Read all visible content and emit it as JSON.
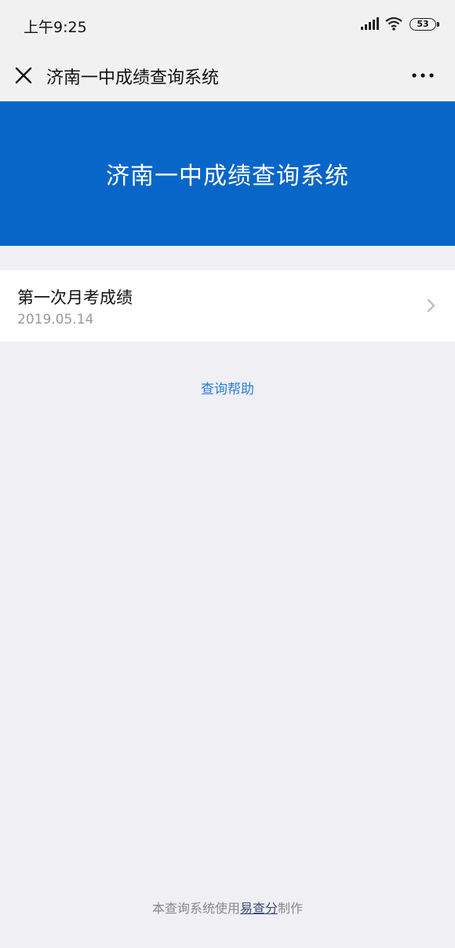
{
  "status_bar": {
    "time": "上午9:25",
    "battery": "53"
  },
  "nav": {
    "title": "济南一中成绩查询系统"
  },
  "banner": {
    "title": "济南一中成绩查询系统"
  },
  "exam_list": [
    {
      "title": "第一次月考成绩",
      "date": "2019.05.14"
    }
  ],
  "help_link": "查询帮助",
  "footer": {
    "prefix": "本查询系统使用",
    "link": "易查分",
    "suffix": "制作"
  },
  "colors": {
    "banner_bg": "#0866c9",
    "link": "#2a7ed8",
    "page_bg": "#efeff4"
  }
}
